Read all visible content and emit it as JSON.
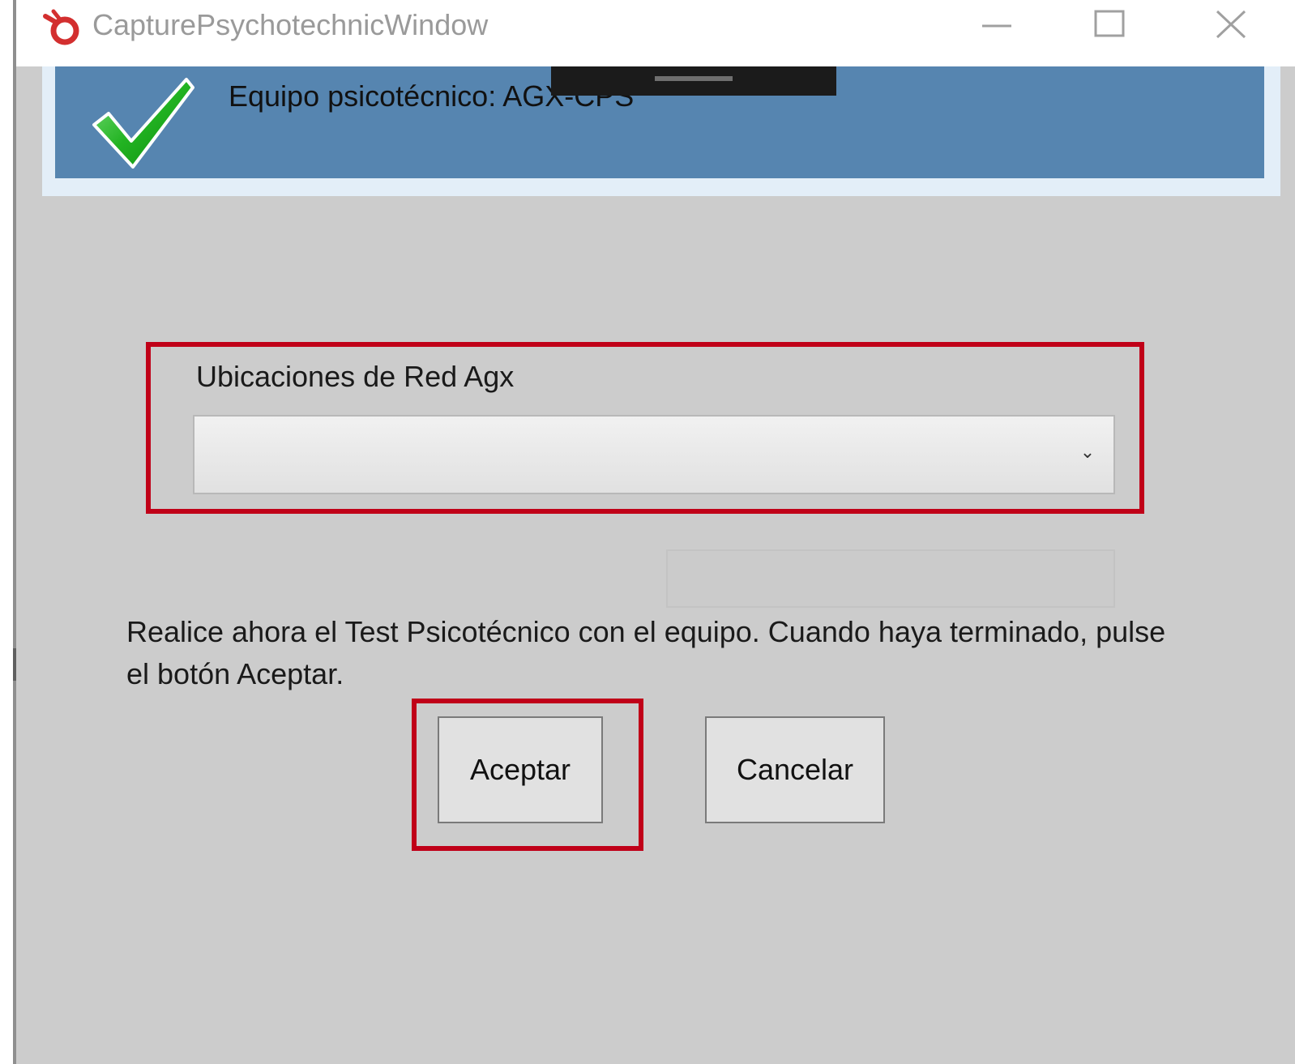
{
  "window": {
    "title": "CapturePsychotechnicWindow",
    "icon": "app-logo-icon",
    "controls": {
      "minimize_icon": "minimize-icon",
      "maximize_icon": "maximize-icon",
      "close_icon": "close-icon"
    }
  },
  "banner": {
    "icon": "checkmark-icon",
    "text": "Equipo psicotécnico: AGX-CPS",
    "background_color": "#5685b0"
  },
  "network_location": {
    "label": "Ubicaciones de Red Agx",
    "selected_value": "",
    "arrow_icon": "chevron-down-icon"
  },
  "secondary_field": {
    "value": ""
  },
  "instructions": {
    "text": "Realice ahora el Test Psicotécnico con el equipo. Cuando haya terminado, pulse el botón Aceptar."
  },
  "buttons": {
    "accept_label": "Aceptar",
    "cancel_label": "Cancelar"
  },
  "highlight_color": "#c00018"
}
